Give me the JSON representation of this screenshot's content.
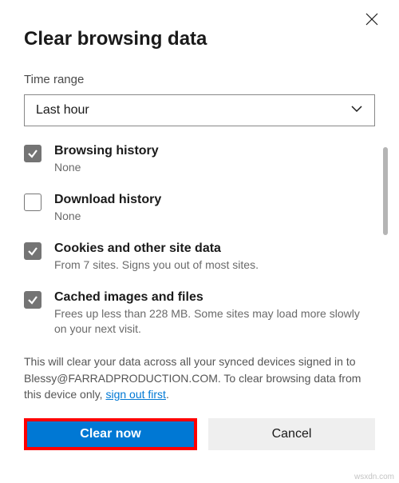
{
  "title": "Clear browsing data",
  "timeRange": {
    "label": "Time range",
    "value": "Last hour"
  },
  "items": [
    {
      "checked": true,
      "title": "Browsing history",
      "sub": "None"
    },
    {
      "checked": false,
      "title": "Download history",
      "sub": "None"
    },
    {
      "checked": true,
      "title": "Cookies and other site data",
      "sub": "From 7 sites. Signs you out of most sites."
    },
    {
      "checked": true,
      "title": "Cached images and files",
      "sub": "Frees up less than 228 MB. Some sites may load more slowly on your next visit."
    }
  ],
  "footer": {
    "prefix": "This will clear your data across all your synced devices signed in to Blessy@FARRADPRODUCTION.COM. To clear browsing data from this device only, ",
    "link": "sign out first",
    "suffix": "."
  },
  "buttons": {
    "primary": "Clear now",
    "secondary": "Cancel"
  },
  "watermark": "wsxdn.com"
}
